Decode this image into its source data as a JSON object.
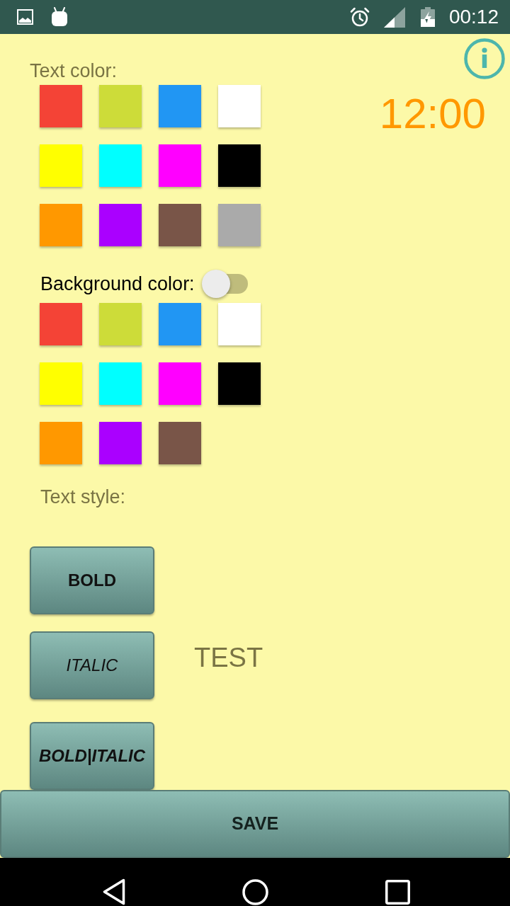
{
  "status_bar": {
    "time": "00:12"
  },
  "clock": {
    "time": "12:00"
  },
  "text_color": {
    "label": "Text color:",
    "swatches": [
      {
        "color": "#f44336"
      },
      {
        "color": "#cddc39"
      },
      {
        "color": "#2196f3"
      },
      {
        "color": "#ffffff"
      },
      {
        "color": "#ffff00"
      },
      {
        "color": "#00ffff"
      },
      {
        "color": "#ff00ff"
      },
      {
        "color": "#000000"
      },
      {
        "color": "#ff9800"
      },
      {
        "color": "#aa00ff"
      },
      {
        "color": "#795548"
      },
      {
        "color": "#aaaaaa"
      }
    ]
  },
  "background_color": {
    "label": "Background color:",
    "on": false,
    "swatches": [
      {
        "color": "#f44336"
      },
      {
        "color": "#cddc39"
      },
      {
        "color": "#2196f3"
      },
      {
        "color": "#ffffff"
      },
      {
        "color": "#ffff00"
      },
      {
        "color": "#00ffff"
      },
      {
        "color": "#ff00ff"
      },
      {
        "color": "#000000"
      },
      {
        "color": "#ff9800"
      },
      {
        "color": "#aa00ff"
      },
      {
        "color": "#795548"
      }
    ]
  },
  "text_style": {
    "label": "Text style:",
    "buttons": [
      {
        "label": "BOLD",
        "kind": "bold"
      },
      {
        "label": "ITALIC",
        "kind": "italic"
      },
      {
        "label": "BOLD|ITALIC",
        "kind": "bold_italic"
      }
    ]
  },
  "preview": {
    "text": "TEST"
  },
  "save_button": {
    "label": "SAVE"
  }
}
